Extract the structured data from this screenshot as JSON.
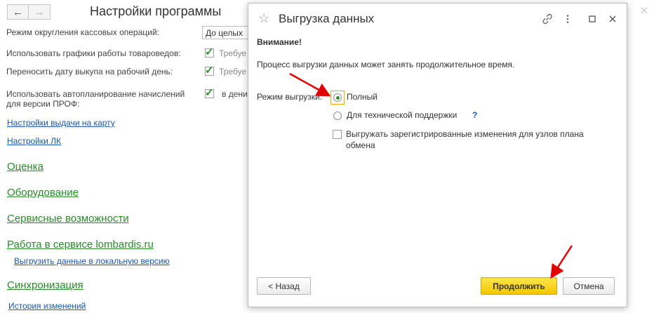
{
  "background": {
    "title": "Настройки программы",
    "nav_back": "←",
    "nav_forward": "→",
    "rows": {
      "rounding_label": "Режим округления кассовых операций:",
      "rounding_value": "До целых",
      "schedules_label": "Использовать графики работы товароведов:",
      "schedules_value": "Требуе",
      "transfer_label": "Переносить дату выкупа на рабочий день:",
      "transfer_value": "Требуе",
      "autoplan_label_1": "Использовать автопланирование начислений",
      "autoplan_label_2": "для версии ПРОФ:",
      "autoplan_value": "в дени"
    },
    "links": {
      "card": "Настройки выдачи на карту",
      "lk": "Настройки ЛК"
    },
    "sections": {
      "valuation": "Оценка",
      "equipment": "Оборудование",
      "service": "Сервисные возможности",
      "lombardis": "Работа в сервисе lombardis.ru",
      "sync": "Синхронизация"
    },
    "sublinks": {
      "export_local": "Выгрузить данные в локальную версию",
      "history": "История изменений"
    }
  },
  "dialog": {
    "title": "Выгрузка данных",
    "warning": "Внимание!",
    "message": "Процесс выгрузки данных может занять продолжительное время.",
    "mode_label": "Режим выгрузки:",
    "options": [
      {
        "label": "Полный",
        "selected": true
      },
      {
        "label": "Для технической поддержки",
        "selected": false
      }
    ],
    "help_mark": "?",
    "checkbox_label": "Выгружать зарегистрированные изменения для узлов плана обмена",
    "buttons": {
      "back": "< Назад",
      "continue": "Продолжить",
      "cancel": "Отмена"
    }
  },
  "colors": {
    "accent_button": "#f2c800",
    "section_link": "#2a8a2a",
    "link": "#1a56b0",
    "arrow": "#e00000"
  }
}
